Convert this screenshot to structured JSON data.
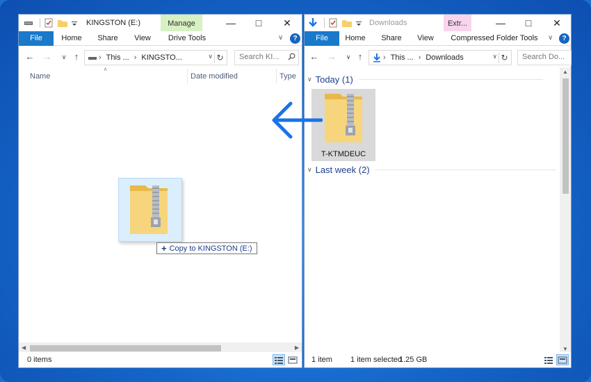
{
  "left_window": {
    "title": "KINGSTON (E:)",
    "context_tab": "Manage",
    "ribbon_tabs": [
      "File",
      "Home",
      "Share",
      "View",
      "Drive Tools"
    ],
    "address": [
      "This ...",
      "KINGSTO..."
    ],
    "search_placeholder": "Search KI...",
    "columns": [
      "Name",
      "Date modified",
      "Type"
    ],
    "status": "0 items"
  },
  "right_window": {
    "title": "Downloads",
    "context_tab": "Extr...",
    "ribbon_tabs": [
      "File",
      "Home",
      "Share",
      "View",
      "Compressed Folder Tools"
    ],
    "address": [
      "This ...",
      "Downloads"
    ],
    "search_placeholder": "Search Do...",
    "groups": [
      {
        "label": "Today (1)"
      },
      {
        "label": "Last week (2)"
      }
    ],
    "file": {
      "name": "T-KTMDEUC"
    },
    "status_count": "1 item",
    "status_selected": "1 item selected",
    "status_size": "1.25 GB"
  },
  "drag": {
    "tooltip": "Copy to KINGSTON (E:)"
  },
  "icons": {
    "back": "back-arrow-icon",
    "forward": "forward-arrow-icon",
    "up": "up-arrow-icon",
    "refresh": "refresh-icon",
    "search": "search-icon",
    "zip_folder": "zip-folder-icon",
    "move_direction": "left-arrow-icon"
  },
  "colors": {
    "accent": "#1979ca",
    "context_manage": "#d7f0c4",
    "context_extract": "#f8d5ec",
    "arrow": "#1a73e8"
  }
}
